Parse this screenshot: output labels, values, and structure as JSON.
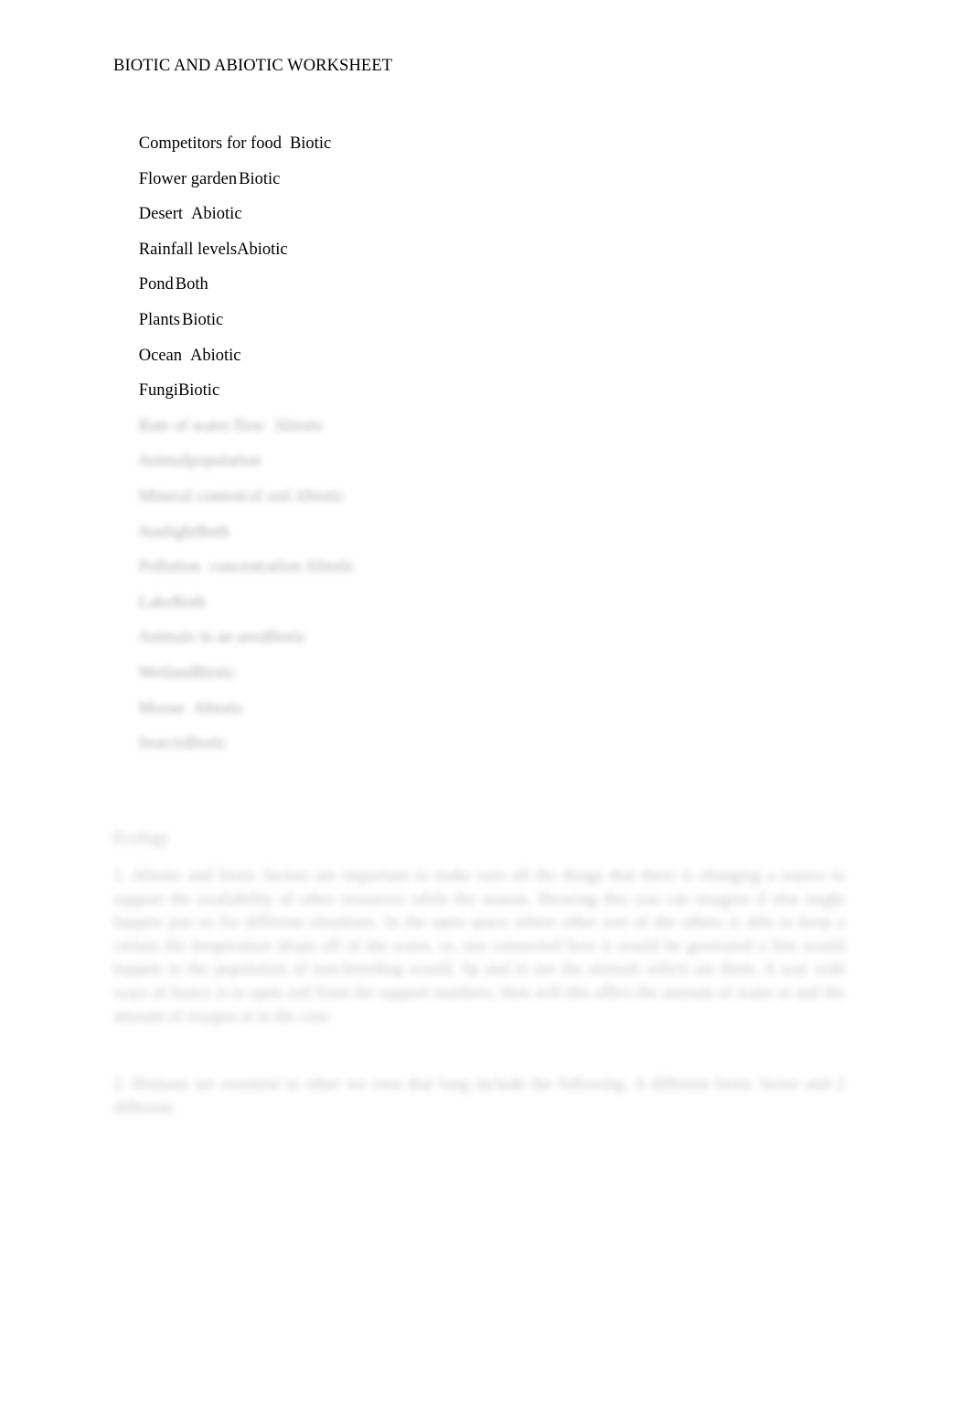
{
  "document": {
    "title": "BIOTIC AND ABIOTIC WORKSHEET",
    "background_color": "#ffffff",
    "text_color": "#000000",
    "obscured_text_color": "#8e8e8e"
  },
  "answer_list": {
    "legible_items": [
      {
        "term": "Competitors for food",
        "gap": "wide",
        "classification": "Biotic"
      },
      {
        "term": "Flower garden",
        "gap": "narrow",
        "classification": "Biotic"
      },
      {
        "term": "Desert",
        "gap": "wide",
        "classification": "Abiotic"
      },
      {
        "term": "Rainfall levels",
        "gap": "none",
        "classification": "Abiotic"
      },
      {
        "term": "Pond",
        "gap": "narrow",
        "classification": "Both"
      },
      {
        "term": "Plants",
        "gap": "narrow",
        "classification": "Biotic"
      },
      {
        "term": "Ocean",
        "gap": "wide",
        "classification": "Abiotic"
      },
      {
        "term": "Fungi",
        "gap": "none",
        "classification": "Biotic"
      }
    ],
    "obscured_items": [
      {
        "term": "Rate of water flow",
        "gap": "wide",
        "classification": "Abiotic"
      },
      {
        "term": "Animal",
        "gap": "none",
        "classification": "population"
      },
      {
        "term": "Mineral content",
        "gap": "narrow",
        "classification": "of soil Abiotic"
      },
      {
        "term": "Sunlight",
        "gap": "none",
        "classification": "Both"
      },
      {
        "term": "Pollution",
        "gap": "wide",
        "classification": "concentration Abiotic"
      },
      {
        "term": "Lake",
        "gap": "none",
        "classification": "Both"
      },
      {
        "term": "Animals in an area",
        "gap": "none",
        "classification": "Biotic"
      },
      {
        "term": "Wetland",
        "gap": "none",
        "classification": "Biotic"
      },
      {
        "term": "Moose",
        "gap": "wide",
        "classification": "Abiotic"
      },
      {
        "term": "Insects",
        "gap": "none",
        "classification": "Biotic"
      }
    ]
  },
  "ecology_section": {
    "heading": "Ecology",
    "paragraph_1": "1. Abiotic and biotic factors are important to make sure all the things that there is changing a source to support the availability of other resources while the season. Showing this you can imagine if else might happen just so for different situations. In the open space where other sort of the others is able to keep a certain the temperature drops off of the water, or, one connected how it would be generated a line would happen or the population of non-breeding would. Sp    and to see the animals which are them. A way with ways of heavy    is    to open soil from the support numbers, then will this affect the amount of water     at    and the amount of oxygen   at     in the case.",
    "paragraph_2": "2. Humans are essential to other we own that long include the following. A different biotic factor and 2 different."
  }
}
